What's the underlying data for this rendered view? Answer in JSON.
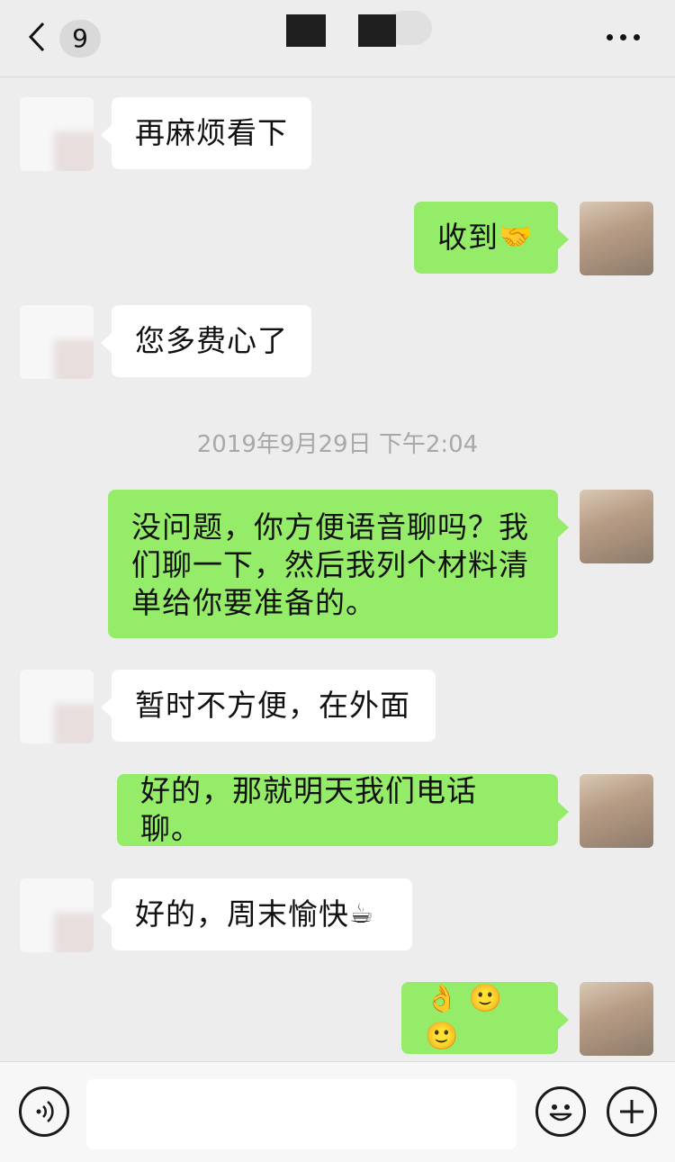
{
  "header": {
    "unread_count": "9",
    "back_label": "back",
    "more_icon": "ellipsis-icon"
  },
  "messages": [
    {
      "side": "left",
      "text": "再麻烦看下"
    },
    {
      "side": "right",
      "text": "收到",
      "emoji": "🤝"
    },
    {
      "side": "left",
      "text": "您多费心了"
    },
    {
      "side": "right",
      "lines": [
        "没问题，你方便语音聊吗？我",
        "们聊一下，然后我列个材料清",
        "单给你要准备的。"
      ]
    },
    {
      "side": "left",
      "text": "暂时不方便，在外面"
    },
    {
      "side": "right",
      "text": "好的，那就明天我们电话聊。"
    },
    {
      "side": "left",
      "text": "好的，周末愉快",
      "emoji": "☕"
    },
    {
      "side": "right",
      "emoji": "👌 🙂 🙂"
    }
  ],
  "timestamp": "2019年9月29日 下午2:04",
  "input": {
    "value": ""
  },
  "bottom_bar": {
    "voice_icon": "voice-icon",
    "emoji_icon": "emoji-face-icon",
    "plus_icon": "plus-icon"
  }
}
